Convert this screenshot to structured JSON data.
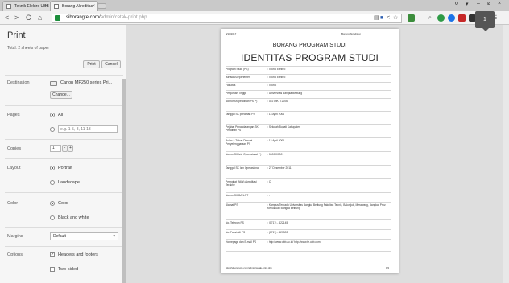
{
  "browser": {
    "tabs": [
      {
        "title": "Teknik Elektro UBB",
        "active": false
      },
      {
        "title": "Borang Akreditasi",
        "active": true
      }
    ],
    "url_host": "siborangte.com/",
    "url_path": "admin/cetak-print.php",
    "window_controls": [
      "o",
      "▾",
      "–",
      "ø",
      "×"
    ],
    "nav": {
      "back": "<",
      "forward": ">",
      "reload": "C",
      "home": "⌂"
    }
  },
  "print_panel": {
    "title": "Print",
    "total": "Total: 2 sheets of paper",
    "print_label": "Print",
    "cancel_label": "Cancel",
    "destination": {
      "label": "Destination",
      "value": "Canon MP250 series Pri...",
      "change_label": "Change..."
    },
    "pages": {
      "label": "Pages",
      "all_label": "All",
      "range_placeholder": "e.g. 1-5, 8, 11-13"
    },
    "copies": {
      "label": "Copies",
      "value": "1",
      "minus": "-",
      "plus": "+"
    },
    "layout": {
      "label": "Layout",
      "portrait": "Portrait",
      "landscape": "Landscape"
    },
    "color": {
      "label": "Color",
      "color_option": "Color",
      "bw_option": "Black and white"
    },
    "margins": {
      "label": "Margins",
      "value": "Default"
    },
    "options": {
      "label": "Options",
      "headers_footers": "Headers and footers",
      "two_sided": "Two-sided"
    }
  },
  "preview": {
    "header_left": "4/10/2017",
    "header_right": "Borang Akreditasi",
    "heading1": "BORANG PROGRAM STUDI",
    "heading2": "IDENTITAS PROGRAM STUDI",
    "rows": [
      {
        "label": "Program Studi (PS)",
        "value": ": Teknik Elektro"
      },
      {
        "label": "Jurusan/Departemen",
        "value": ": Teknik Elektro"
      },
      {
        "label": "Fakultas",
        "value": ": Teknik"
      },
      {
        "label": "Perguruan Tinggi",
        "value": ": Universitas Bangka Belitung"
      },
      {
        "label": "Nomor SK pendirian PS (*)",
        "value": ": 022 DIKTI 2006"
      },
      {
        "label": "Tanggal SK pendirian PS",
        "value": ": 13 April 2006"
      },
      {
        "label": "Pejabat Penandatangan SK Pendirian PS",
        "value": ": Sekolah Bupati Kabupaten"
      },
      {
        "label": "Bulan & Tahun Dimulai Penyelenggaraan PS",
        "value": ": 13 April 2006"
      },
      {
        "label": "Nomor SK Izin Operasional (*)",
        "value": ": 0000000001"
      },
      {
        "label": "Tanggal SK Izin Operasional",
        "value": ": 27 Desember 2011"
      },
      {
        "label": "Peringkat (Nilai) Akreditasi Terakhir",
        "value": ": C"
      },
      {
        "label": "Nomor SK BAN-PT",
        "value": ": -"
      },
      {
        "label": "Alamat PS",
        "value": ": Kampus Terpadu Universitas Bangka Belitung Fakultas Teknik, Balunijuk, Merawang, Bangka, Prov. Kepulauan Bangka Belitung"
      },
      {
        "label": "No. Telepon PS",
        "value": ": (0717) - 422145"
      },
      {
        "label": "No. Faksimili PS",
        "value": ": (0717) - 421303"
      },
      {
        "label": "Homepage dan E-mail PS",
        "value": ": http://www.ubb.ac.id/ http://www.te.ubb.com"
      }
    ],
    "footer_left": "http://siborangte.com/admin/cetak-print.php",
    "footer_right": "1/2"
  },
  "page_badge": "1"
}
